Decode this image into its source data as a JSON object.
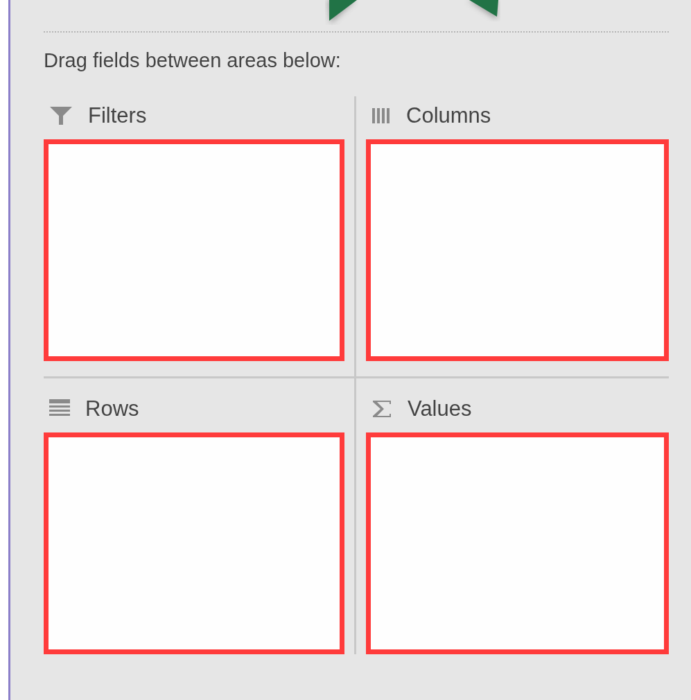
{
  "instruction": "Drag fields between areas below:",
  "areas": [
    {
      "label": "Filters",
      "kind": "filters"
    },
    {
      "label": "Columns",
      "kind": "columns"
    },
    {
      "label": "Rows",
      "kind": "rows"
    },
    {
      "label": "Values",
      "kind": "values"
    }
  ]
}
